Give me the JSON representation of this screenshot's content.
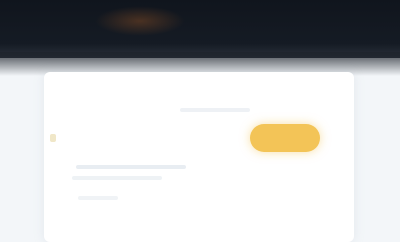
{
  "header": {
    "background": "#151b24"
  },
  "card": {
    "title": "",
    "subtitle": "",
    "cta_label": ""
  },
  "colors": {
    "accent": "#f3c457",
    "page_bg": "#f3f6f9",
    "card_bg": "#ffffff"
  }
}
